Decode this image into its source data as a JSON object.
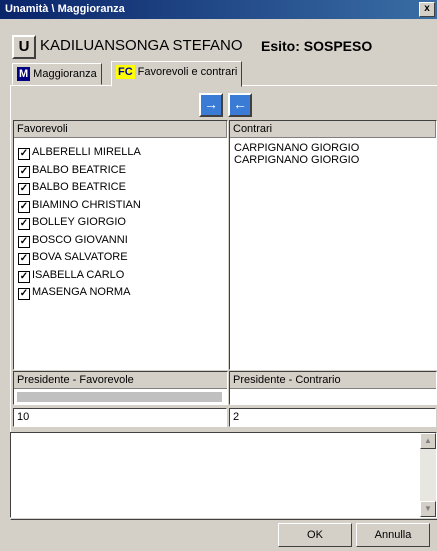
{
  "window": {
    "title": "Unamità \\ Maggioranza",
    "close_label": "x"
  },
  "header": {
    "badge": "U",
    "name": "KADILUANSONGA STEFANO",
    "esito": "Esito: SOSPESO"
  },
  "tabs": [
    {
      "icon": "M",
      "icon_color": "#0000a0",
      "label": "Maggioranza",
      "selected": false
    },
    {
      "icon": "FC",
      "icon_color": "#ffff00",
      "label": "Favorevoli e contrari",
      "selected": true
    }
  ],
  "arrows": {
    "right": "→",
    "left": "←"
  },
  "favorevoli": {
    "header": "Favorevoli",
    "items": [
      {
        "label": "ALBERELLI  MIRELLA",
        "checked": true
      },
      {
        "label": "BALBO BEATRICE",
        "checked": true
      },
      {
        "label": "BALBO BEATRICE",
        "checked": true
      },
      {
        "label": "BIAMINO CHRISTIAN",
        "checked": true
      },
      {
        "label": "BOLLEY GIORGIO",
        "checked": true
      },
      {
        "label": "BOSCO GIOVANNI",
        "checked": true
      },
      {
        "label": "BOVA SALVATORE",
        "checked": true
      },
      {
        "label": "ISABELLA CARLO",
        "checked": true
      },
      {
        "label": "MASENGA NORMA",
        "checked": true
      }
    ]
  },
  "contrari": {
    "header": "Contrari",
    "items": [
      "CARPIGNANO GIORGIO",
      "CARPIGNANO GIORGIO"
    ]
  },
  "presidente": {
    "favorevole_label": "Presidente - Favorevole",
    "contrario_label": "Presidente - Contrario"
  },
  "counts": {
    "favorevoli": "10",
    "contrari": "2"
  },
  "buttons": {
    "ok": "OK",
    "annulla": "Annulla"
  },
  "scroll_icons": {
    "up": "▲",
    "down": "▼"
  },
  "colors": {
    "titlebar": "#0a246a",
    "accent_button": "#3a7bd5",
    "face": "#d4d0c8"
  }
}
